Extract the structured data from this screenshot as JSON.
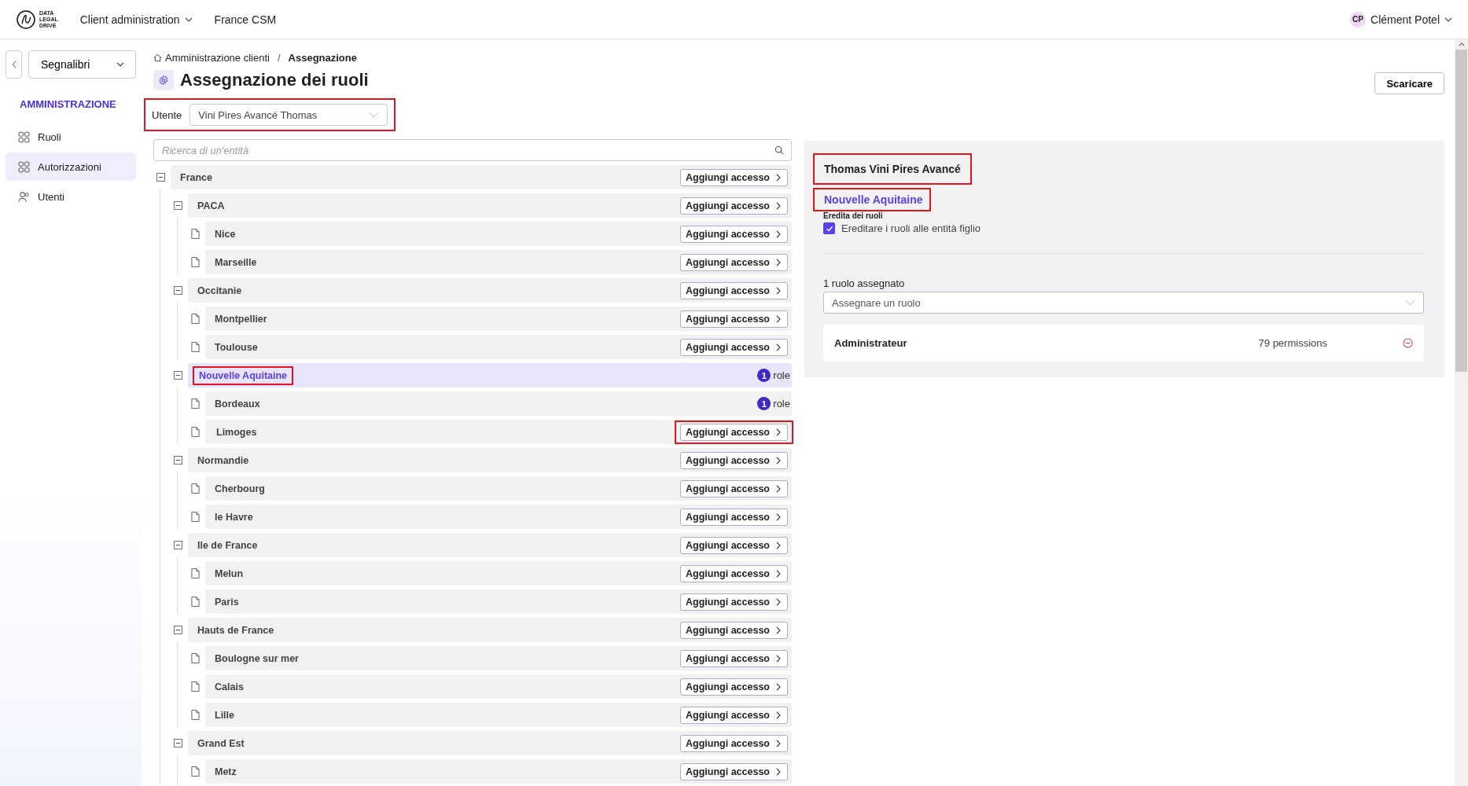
{
  "topbar": {
    "logo_text": [
      "DATA",
      "LEGAL",
      "DRIVE"
    ],
    "menus": [
      {
        "label": "Client administration",
        "dropdown": true
      },
      {
        "label": "France CSM",
        "dropdown": false
      }
    ],
    "user": {
      "initials": "CP",
      "name": "Clément Potel"
    }
  },
  "sidebar": {
    "bookmarks": "Segnalibri",
    "section": "AMMINISTRAZIONE",
    "items": [
      {
        "label": "Ruoli",
        "selected": false
      },
      {
        "label": "Autorizzazioni",
        "selected": true
      },
      {
        "label": "Utenti",
        "selected": false
      }
    ]
  },
  "breadcrumb": [
    {
      "label": "Amministrazione clienti"
    },
    {
      "label": "Assegnazione"
    }
  ],
  "breadcrumb_separator": "/",
  "title": "Assegnazione dei ruoli",
  "download_button": "Scaricare",
  "user_field": {
    "label": "Utente",
    "value": "Vini Pires Avancé Thomas",
    "annotated": true
  },
  "search": {
    "placeholder": "Ricerca di un'entità"
  },
  "tree": [
    {
      "name": "France",
      "expanded": true,
      "selected": false,
      "annotated": false,
      "kind": "access",
      "action": "Aggiungi accesso",
      "children": [
        {
          "name": "PACA",
          "expanded": true,
          "selected": false,
          "annotated": false,
          "kind": "access",
          "action": "Aggiungi accesso",
          "children": [
            {
              "name": "Nice",
              "selected": false,
              "annotated": false,
              "kind": "access",
              "action": "Aggiungi accesso"
            },
            {
              "name": "Marseille",
              "selected": false,
              "annotated": false,
              "kind": "access",
              "action": "Aggiungi accesso"
            }
          ]
        },
        {
          "name": "Occitanie",
          "expanded": true,
          "selected": false,
          "annotated": false,
          "kind": "access",
          "action": "Aggiungi accesso",
          "children": [
            {
              "name": "Montpellier",
              "selected": false,
              "annotated": false,
              "kind": "access",
              "action": "Aggiungi accesso"
            },
            {
              "name": "Toulouse",
              "selected": false,
              "annotated": false,
              "kind": "access",
              "action": "Aggiungi accesso"
            }
          ]
        },
        {
          "name": "Nouvelle Aquitaine",
          "expanded": true,
          "selected": true,
          "annotated": true,
          "kind": "roles",
          "count": "1",
          "unit": "role",
          "children": [
            {
              "name": "Bordeaux",
              "selected": false,
              "annotated": false,
              "kind": "roles",
              "count": "1",
              "unit": "role"
            },
            {
              "name": "Limoges",
              "selected": false,
              "annotated": true,
              "kind": "access",
              "action": "Aggiungi accesso"
            }
          ]
        },
        {
          "name": "Normandie",
          "expanded": true,
          "selected": false,
          "annotated": false,
          "kind": "access",
          "action": "Aggiungi accesso",
          "children": [
            {
              "name": "Cherbourg",
              "selected": false,
              "annotated": false,
              "kind": "access",
              "action": "Aggiungi accesso"
            },
            {
              "name": "le Havre",
              "selected": false,
              "annotated": false,
              "kind": "access",
              "action": "Aggiungi accesso"
            }
          ]
        },
        {
          "name": "Ile de France",
          "expanded": true,
          "selected": false,
          "annotated": false,
          "kind": "access",
          "action": "Aggiungi accesso",
          "children": [
            {
              "name": "Melun",
              "selected": false,
              "annotated": false,
              "kind": "access",
              "action": "Aggiungi accesso"
            },
            {
              "name": "Paris",
              "selected": false,
              "annotated": false,
              "kind": "access",
              "action": "Aggiungi accesso"
            }
          ]
        },
        {
          "name": "Hauts de France",
          "expanded": true,
          "selected": false,
          "annotated": false,
          "kind": "access",
          "action": "Aggiungi accesso",
          "children": [
            {
              "name": "Boulogne sur mer",
              "selected": false,
              "annotated": false,
              "kind": "access",
              "action": "Aggiungi accesso"
            },
            {
              "name": "Calais",
              "selected": false,
              "annotated": false,
              "kind": "access",
              "action": "Aggiungi accesso"
            },
            {
              "name": "Lille",
              "selected": false,
              "annotated": false,
              "kind": "access",
              "action": "Aggiungi accesso"
            }
          ]
        },
        {
          "name": "Grand Est",
          "expanded": true,
          "selected": false,
          "annotated": false,
          "kind": "access",
          "action": "Aggiungi accesso",
          "children": [
            {
              "name": "Metz",
              "selected": false,
              "annotated": false,
              "kind": "access",
              "action": "Aggiungi accesso"
            }
          ]
        }
      ]
    }
  ],
  "detail": {
    "user_name": "Thomas Vini Pires Avancé",
    "user_annotated": true,
    "entity": "Nouvelle Aquitaine",
    "entity_annotated": true,
    "inherit_heading": "Eredita dei ruoli",
    "inherit_label": "Ereditare i ruoli alle entità figlio",
    "inherit_checked": true,
    "assigned_count": "1 ruolo assegnato",
    "role_placeholder": "Assegnare un ruolo",
    "roles": [
      {
        "name": "Administrateur",
        "permissions": "79 permissions"
      }
    ]
  }
}
